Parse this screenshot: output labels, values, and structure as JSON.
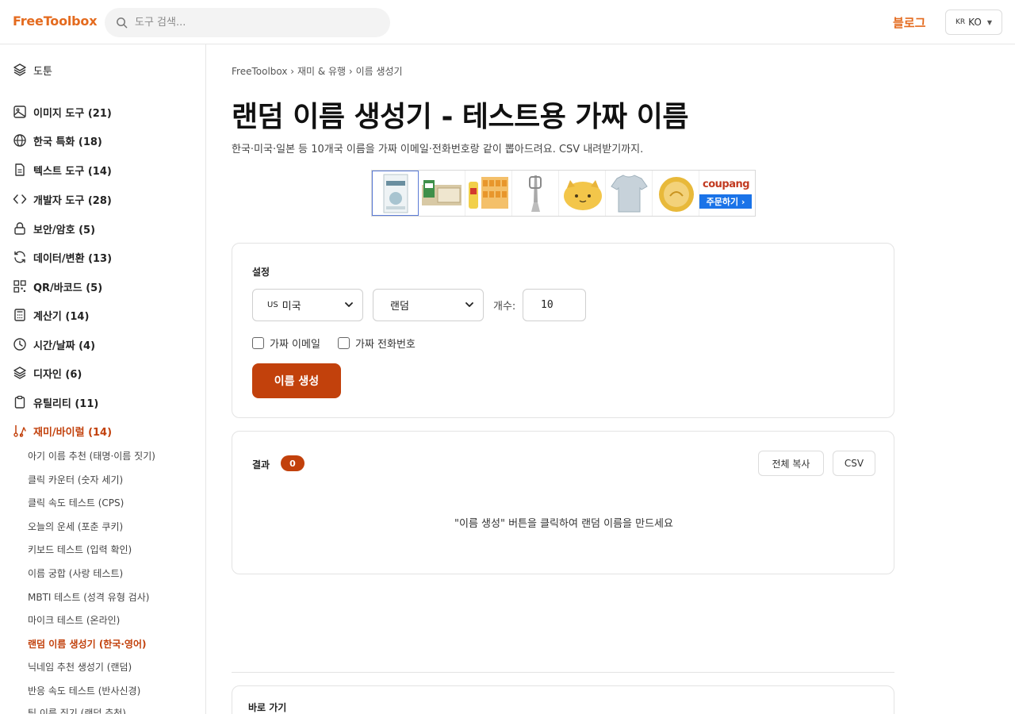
{
  "header": {
    "logo": "FreeToolbox",
    "search_placeholder": "도구 검색...",
    "blog_label": "블로그",
    "lang_flag": "KR",
    "lang_label": "KO"
  },
  "sidebar": {
    "top_item": "도툰",
    "categories": [
      {
        "label": "이미지 도구 (21)",
        "icon": "image-icon"
      },
      {
        "label": "한국 특화 (18)",
        "icon": "globe-icon"
      },
      {
        "label": "텍스트 도구 (14)",
        "icon": "document-icon"
      },
      {
        "label": "개발자 도구 (28)",
        "icon": "code-icon"
      },
      {
        "label": "보안/암호 (5)",
        "icon": "lock-icon"
      },
      {
        "label": "데이터/변환 (13)",
        "icon": "refresh-icon"
      },
      {
        "label": "QR/바코드 (5)",
        "icon": "qr-icon"
      },
      {
        "label": "계산기 (14)",
        "icon": "calculator-icon"
      },
      {
        "label": "시간/날짜 (4)",
        "icon": "clock-icon"
      },
      {
        "label": "디자인 (6)",
        "icon": "layers-icon"
      },
      {
        "label": "유틸리티 (11)",
        "icon": "clipboard-icon"
      },
      {
        "label": "재미/바이럴 (14)",
        "icon": "fun-icon"
      }
    ],
    "sub_items": [
      "아기 이름 추천 (태명·이름 짓기)",
      "클릭 카운터 (숫자 세기)",
      "클릭 속도 테스트 (CPS)",
      "오늘의 운세 (포춘 쿠키)",
      "키보드 테스트 (입력 확인)",
      "이름 궁합 (사랑 테스트)",
      "MBTI 테스트 (성격 유형 검사)",
      "마이크 테스트 (온라인)",
      "랜덤 이름 생성기 (한국·영어)",
      "닉네임 추천 생성기 (랜덤)",
      "반응 속도 테스트 (반사신경)",
      "팀 이름 짓기 (랜덤 추천)"
    ]
  },
  "breadcrumb": {
    "home": "FreeToolbox",
    "sep1": "›",
    "category": "재미 & 유행",
    "sep2": "›",
    "current": "이름 생성기"
  },
  "page": {
    "title": "랜덤 이름 생성기 - 테스트용 가짜 이름",
    "description": "한국·미국·일본 등 10개국 이름을 가짜 이메일·전화번호랑 같이 뽑아드려요. CSV 내려받기까지."
  },
  "ad": {
    "coupang_logo": "coupang",
    "coupang_button": "주문하기 ›"
  },
  "settings": {
    "label": "설정",
    "country_flag": "US",
    "country_value": "미국",
    "gender_value": "랜덤",
    "count_label": "개수:",
    "count_value": "10",
    "fake_email_label": "가짜 이메일",
    "fake_phone_label": "가짜 전화번호",
    "generate_label": "이름 생성"
  },
  "results": {
    "label": "결과",
    "count": "0",
    "copy_all_label": "전체 복사",
    "csv_label": "CSV",
    "empty_message": "\"이름 생성\" 버튼을 클릭하여 랜덤 이름을 만드세요"
  },
  "quick": {
    "title": "바로 가기"
  },
  "colors": {
    "accent": "#c2410c",
    "brand": "#e46b1f"
  }
}
